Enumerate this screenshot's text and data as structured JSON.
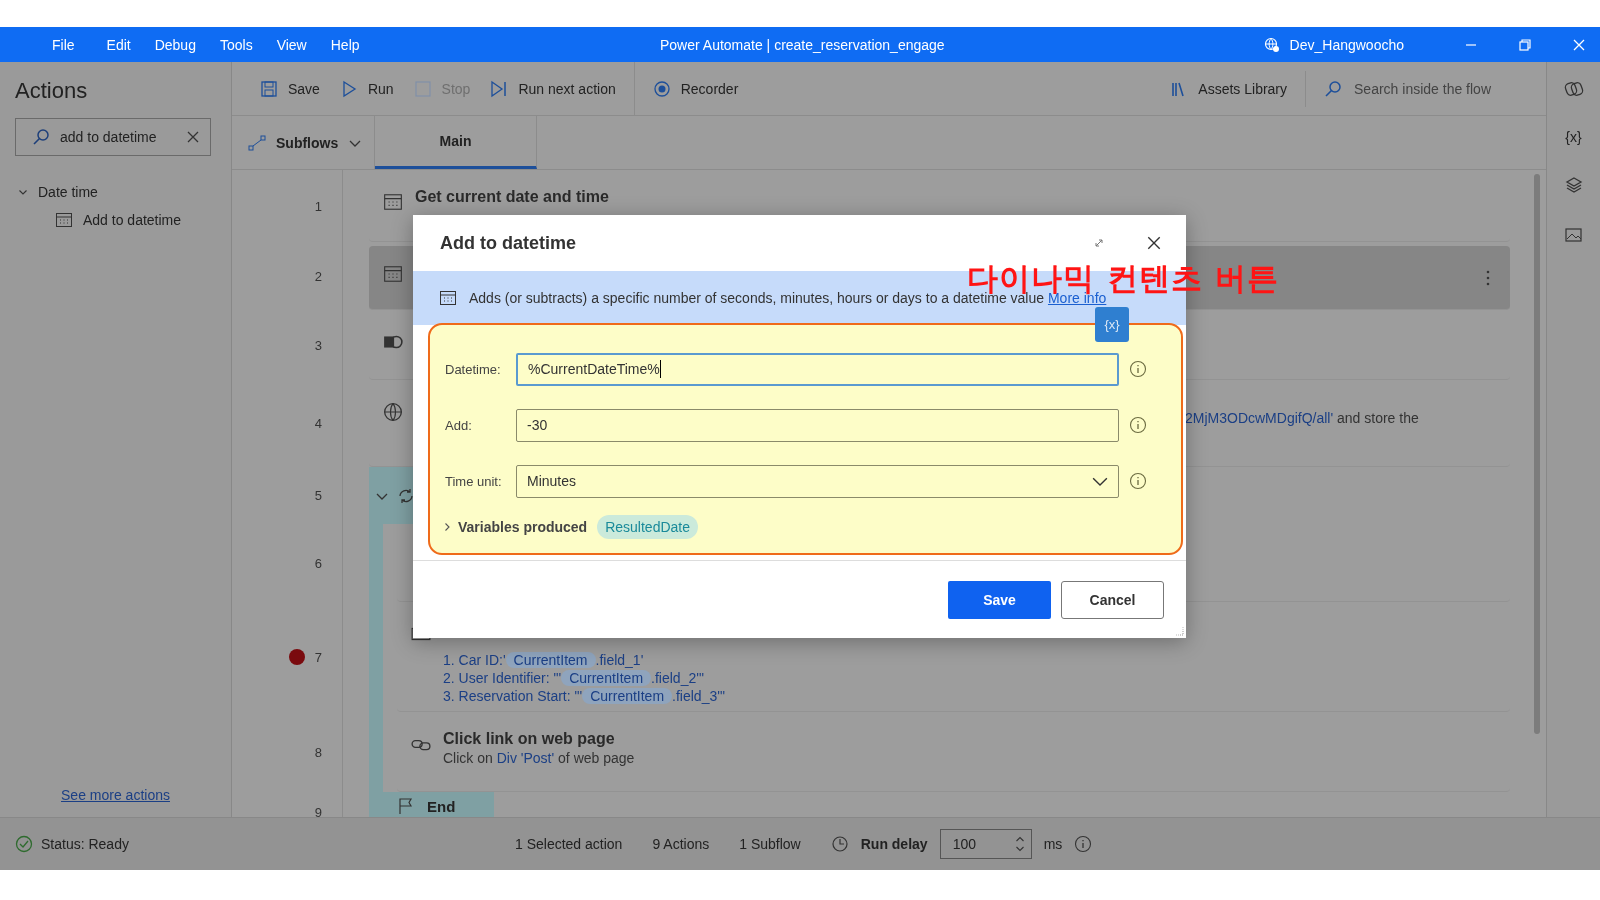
{
  "window": {
    "title": "Power Automate | create_reservation_engage",
    "user": "Dev_Hangwoocho"
  },
  "menu": [
    "File",
    "Edit",
    "Debug",
    "Tools",
    "View",
    "Help"
  ],
  "actions_panel": {
    "title": "Actions",
    "search": {
      "value": "add to datetime"
    },
    "tree": [
      {
        "label": "Date time",
        "expanded": true,
        "children": [
          {
            "label": "Add to datetime"
          }
        ]
      }
    ],
    "more_link": "See more actions"
  },
  "toolbar": [
    {
      "label": "Save",
      "kind": "save",
      "disabled": false
    },
    {
      "label": "Run",
      "kind": "run",
      "disabled": false
    },
    {
      "label": "Stop",
      "kind": "stop",
      "disabled": true
    },
    {
      "label": "Run next action",
      "kind": "next",
      "disabled": false
    },
    {
      "label": "Recorder",
      "kind": "record",
      "disabled": false
    }
  ],
  "assets_library": "Assets Library",
  "flow_search": {
    "placeholder": "Search inside the flow"
  },
  "subflows_button": "Subflows",
  "tabs": [
    {
      "label": "Main",
      "selected": true
    }
  ],
  "right_rail": [
    {
      "kind": "copilot"
    },
    {
      "kind": "variables",
      "label": "{x}"
    },
    {
      "kind": "layers"
    },
    {
      "kind": "images"
    }
  ],
  "steps": [
    {
      "number": "1",
      "kind": "action",
      "title": "Get current date and time",
      "selected": false,
      "breakpoint": false
    },
    {
      "number": "2",
      "kind": "action",
      "selected": true,
      "breakpoint": false
    },
    {
      "number": "3",
      "kind": "action",
      "selected": false,
      "breakpoint": false
    },
    {
      "number": "4",
      "kind": "action",
      "selected": false,
      "breakpoint": false,
      "lines": [
        [
          {
            "kind": "link",
            "text": "2MjM3ODcwMDgifQ/all'"
          },
          {
            "kind": "text",
            "text": " and store the"
          }
        ]
      ]
    },
    {
      "number": "5",
      "kind": "loop",
      "selected": false,
      "breakpoint": false
    },
    {
      "number": "6",
      "kind": "action",
      "selected": false,
      "breakpoint": false
    },
    {
      "number": "7",
      "kind": "action",
      "selected": false,
      "breakpoint": true,
      "lines": [
        [
          {
            "kind": "link",
            "text": "1. Car ID:'"
          },
          {
            "kind": "var",
            "text": "CurrentItem"
          },
          {
            "kind": "link",
            "text": ".field_1'"
          }
        ],
        [
          {
            "kind": "link",
            "text": "2. User Identifier: \"'"
          },
          {
            "kind": "var",
            "text": "CurrentItem"
          },
          {
            "kind": "link",
            "text": ".field_2'\""
          }
        ],
        [
          {
            "kind": "link",
            "text": "3. Reservation Start: \"'"
          },
          {
            "kind": "var",
            "text": "CurrentItem"
          },
          {
            "kind": "link",
            "text": ".field_3'\""
          }
        ]
      ]
    },
    {
      "number": "8",
      "kind": "action",
      "title": "Click link on web page",
      "selected": false,
      "breakpoint": false,
      "lines": [
        [
          {
            "kind": "text",
            "text": "Click on "
          },
          {
            "kind": "link",
            "text": "Div 'Post'"
          },
          {
            "kind": "text",
            "text": " of web page"
          }
        ]
      ]
    },
    {
      "number": "9",
      "kind": "end",
      "title": "End",
      "selected": false,
      "breakpoint": false
    }
  ],
  "dialog": {
    "title": "Add to datetime",
    "description": "Adds (or subtracts) a specific number of seconds, minutes, hours or days to a datetime value",
    "more_info": "More info",
    "fields": [
      {
        "label": "Datetime:",
        "value": "%CurrentDateTime%",
        "kind": "text",
        "focused": true
      },
      {
        "label": "Add:",
        "value": "-30",
        "kind": "text",
        "focused": false
      },
      {
        "label": "Time unit:",
        "value": "Minutes",
        "kind": "dropdown",
        "focused": false
      }
    ],
    "variables_produced": {
      "label": "Variables produced",
      "expanded": false,
      "variables": [
        "ResultedDate"
      ]
    },
    "dynamic_content_button": "{x}",
    "annotation": "다이나믹 컨텐츠 버튼",
    "buttons": [
      {
        "label": "Save",
        "kind": "primary"
      },
      {
        "label": "Cancel",
        "kind": "secondary"
      }
    ]
  },
  "status_bar": {
    "status": "Status: Ready",
    "selected": "1 Selected action",
    "actions": "9 Actions",
    "subflows": "1 Subflow",
    "run_delay_label": "Run delay",
    "run_delay": "100",
    "unit": "ms"
  }
}
